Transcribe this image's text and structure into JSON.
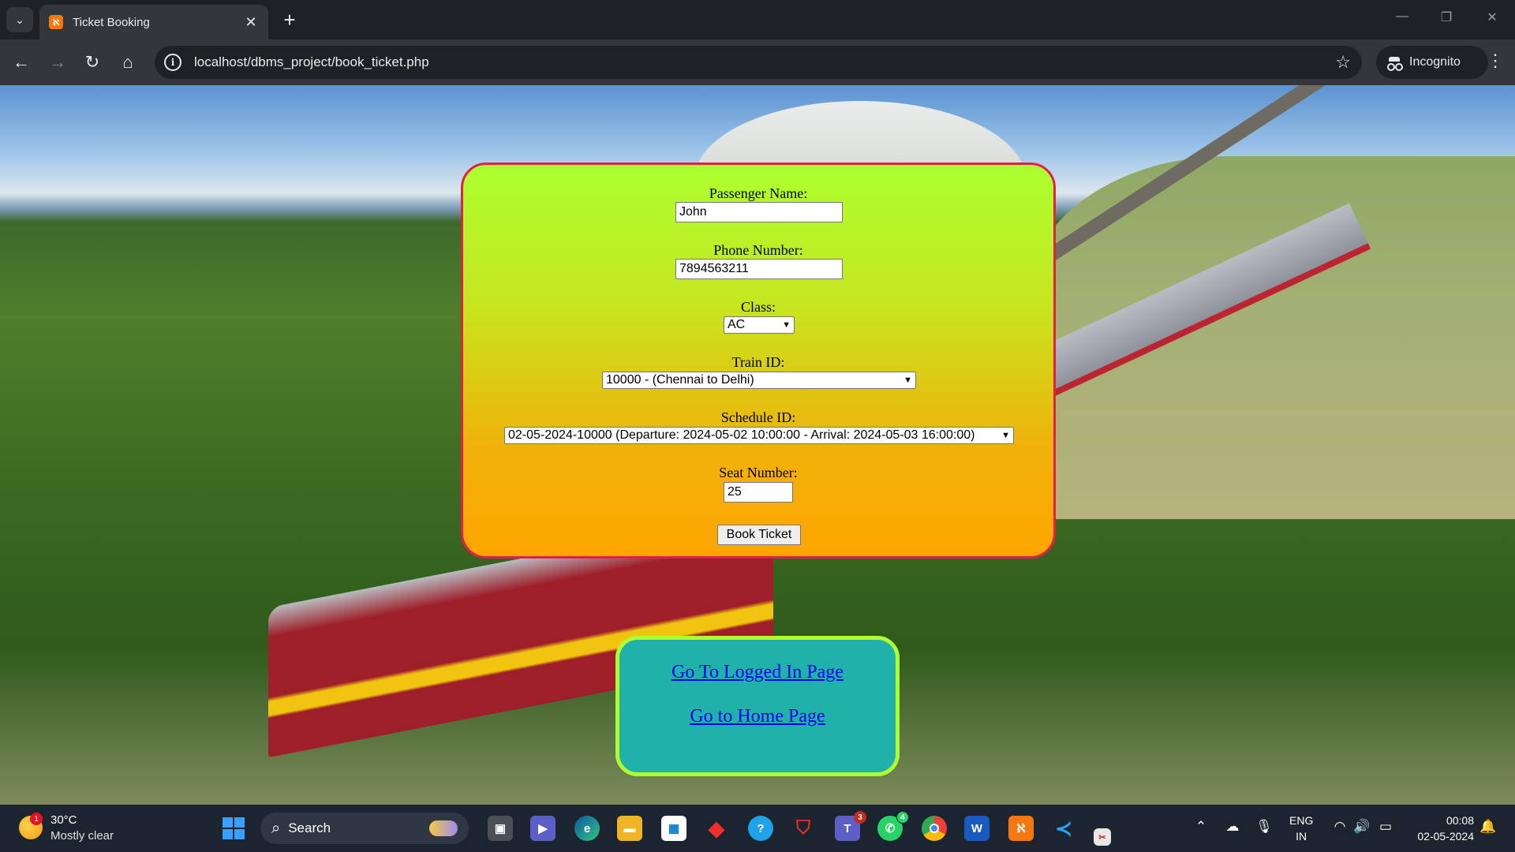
{
  "browser": {
    "tab_title": "Ticket Booking",
    "url": "localhost/dbms_project/book_ticket.php",
    "profile_label": "Incognito"
  },
  "form": {
    "passenger_name": {
      "label": "Passenger Name:",
      "value": "John"
    },
    "phone_number": {
      "label": "Phone Number:",
      "value": "7894563211"
    },
    "class": {
      "label": "Class:",
      "selected": "AC"
    },
    "train_id": {
      "label": "Train ID:",
      "selected": "10000 - (Chennai to Delhi)"
    },
    "schedule_id": {
      "label": "Schedule ID:",
      "selected": "02-05-2024-10000 (Departure: 2024-05-02 10:00:00 - Arrival: 2024-05-03 16:00:00)"
    },
    "seat_number": {
      "label": "Seat Number:",
      "value": "25"
    },
    "submit_label": "Book Ticket"
  },
  "links": {
    "logged_in": "Go To Logged In Page",
    "home": "Go to Home Page"
  },
  "taskbar": {
    "weather_temp": "30°C",
    "weather_desc": "Mostly clear",
    "weather_badge": "1",
    "search_label": "Search",
    "teams_badge": "3",
    "whatsapp_badge": "4",
    "lang_line1": "ENG",
    "lang_line2": "IN",
    "time": "00:08",
    "date": "02-05-2024"
  },
  "colors": {
    "form_gradient_top": "#acff2f",
    "form_gradient_bottom": "#ffa500",
    "form_border": "#e0204a",
    "links_bg": "#20b2aa",
    "links_border": "#adff2f",
    "link_color": "#0000ee"
  }
}
